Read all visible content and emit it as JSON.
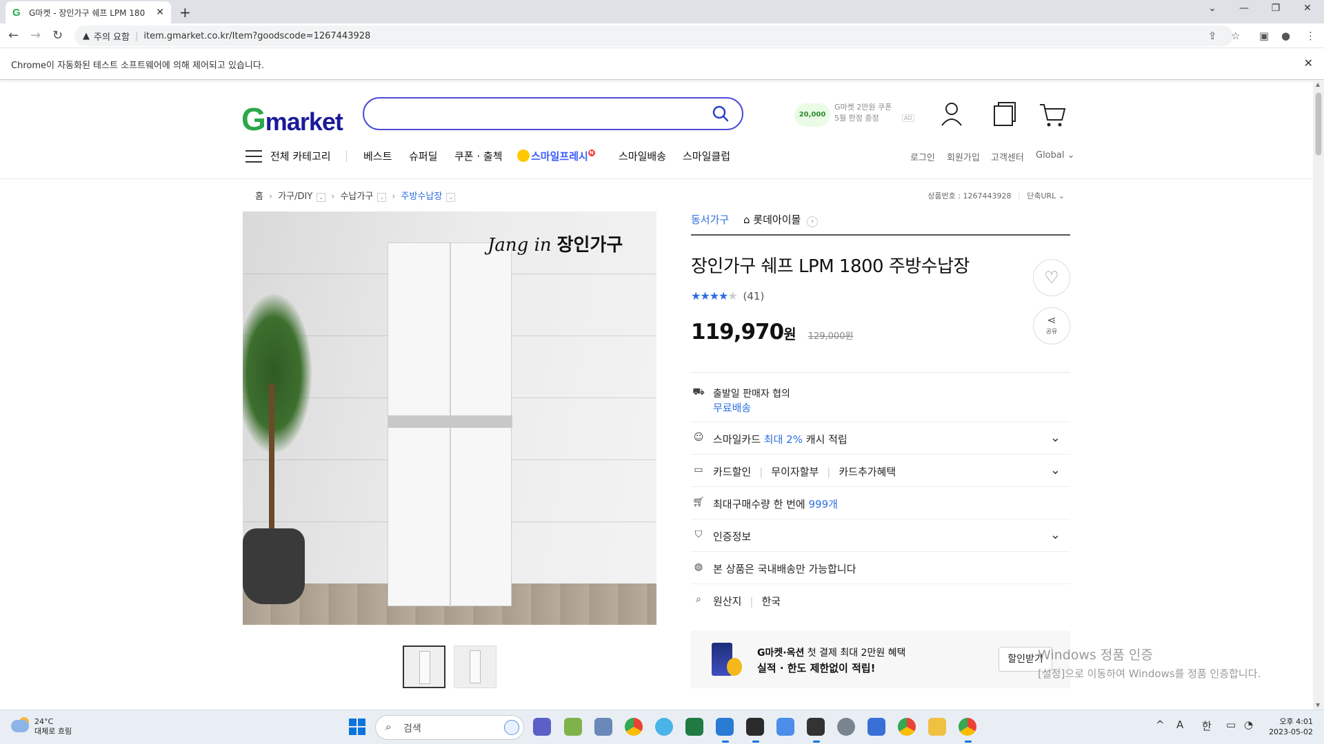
{
  "browser": {
    "tab_title": "G마켓 - 장인가구 쉐프 LPM 180",
    "tab_favicon": "G",
    "security_label": "주의 요함",
    "url": "item.gmarket.co.kr/Item?goodscode=1267443928",
    "infobar_text": "Chrome이 자동화된 테스트 소프트웨어에 의해 제어되고 있습니다."
  },
  "header": {
    "logo_g": "G",
    "logo_text": "market",
    "search_placeholder": "",
    "coupon_badge": "20,000",
    "coupon_line1": "G마켓 2만원 쿠폰",
    "coupon_line2": "5월 한정 증정",
    "coupon_ad": "AD"
  },
  "gnb": {
    "all_categories": "전체 카테고리",
    "items": [
      "베스트",
      "슈퍼딜",
      "쿠폰 · 출첵",
      "스마일프레시",
      "스마일배송",
      "스마일클럽"
    ],
    "fresh_badge": "N",
    "util": [
      "로그인",
      "회원가입",
      "고객센터",
      "Global"
    ]
  },
  "breadcrumb": {
    "home": "홈",
    "levels": [
      "가구/DIY",
      "수납가구",
      "주방수납장"
    ],
    "goods_no_label": "상품번호 : 1267443928",
    "short_url": "단축URL"
  },
  "image": {
    "brand_script": "Jang in",
    "brand_name": "장인가구"
  },
  "product": {
    "category_link": "동서가구",
    "store_name": "롯데아이몰",
    "title": "장인가구 쉐프 LPM 1800 주방수납장",
    "rating": 3.5,
    "review_count": "(41)",
    "sale_price": "119,970",
    "sale_unit": "원",
    "original_price": "129,000원",
    "share_label": "공유"
  },
  "info_rows": {
    "shipping": "출발일 판매자 협의",
    "free_shipping": "무료배송",
    "smilecard_pre": "스마일카드 ",
    "smilecard_hl": "최대 2%",
    "smilecard_post": " 캐시 적립",
    "card_discount": "카드할인",
    "installment": "무이자할부",
    "card_benefit": "카드추가혜택",
    "max_qty_pre": "최대구매수량 한 번에 ",
    "max_qty_hl": "999개",
    "certification": "인증정보",
    "domestic": "본 상품은 국내배송만 가능합니다",
    "origin_label": "원산지",
    "origin_value": "한국"
  },
  "banner": {
    "line1_bold": "G마켓·옥션",
    "line1_rest": " 첫 결제 최대 2만원 혜택",
    "line2": "실적 · 한도 제한없이 적립!",
    "button": "할인받기"
  },
  "watermark": {
    "line1": "Windows 정품 인증",
    "line2": "[설정]으로 이동하여 Windows를 정품 인증합니다."
  },
  "taskbar": {
    "temp": "24°C",
    "weather": "대체로 흐림",
    "search": "검색",
    "ime_a": "A",
    "ime_han": "한",
    "time": "오후 4:01",
    "date": "2023-05-02"
  }
}
